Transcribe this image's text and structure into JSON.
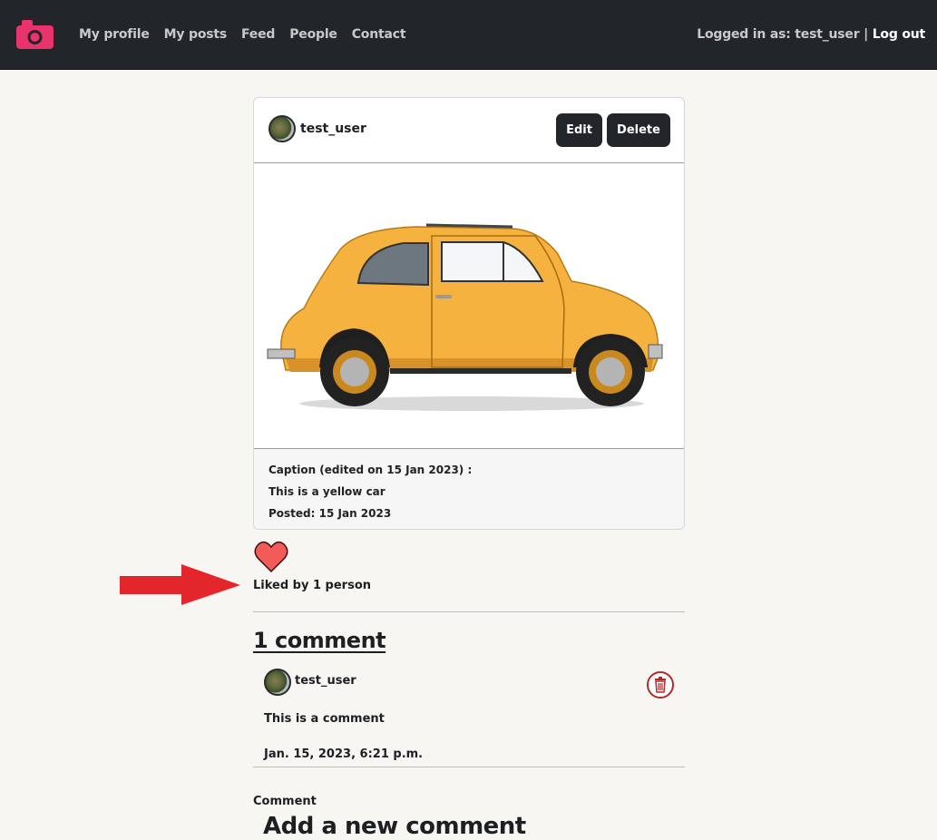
{
  "nav": {
    "logo_icon": "camera-icon",
    "links": [
      "My profile",
      "My posts",
      "Feed",
      "People",
      "Contact"
    ],
    "logged_in_prefix": "Logged in as: test_user |",
    "logout_label": "Log out"
  },
  "post": {
    "username": "test_user",
    "edit_label": "Edit",
    "delete_label": "Delete",
    "image_icon": "yellow-car-image",
    "caption_header": "Caption (edited on 15 Jan 2023) :",
    "caption": "This is a yellow car",
    "posted": "Posted: 15 Jan 2023"
  },
  "likes": {
    "icon": "heart-icon",
    "text": "Liked by 1 person",
    "annotation": "red-arrow"
  },
  "comments": {
    "title": "1 comment",
    "items": [
      {
        "username": "test_user",
        "text": "This is a comment",
        "date": "Jan. 15, 2023, 6:21 p.m.",
        "delete_icon": "trash-icon"
      }
    ]
  },
  "new_comment": {
    "label": "Comment",
    "heading": "Add a new comment"
  },
  "colors": {
    "navbar": "#22252a",
    "logo": "#e8336d",
    "heart": "#f35b5b",
    "arrow": "#e3262b",
    "page_bg": "#f7f6f2",
    "car": "#f6b23f"
  }
}
